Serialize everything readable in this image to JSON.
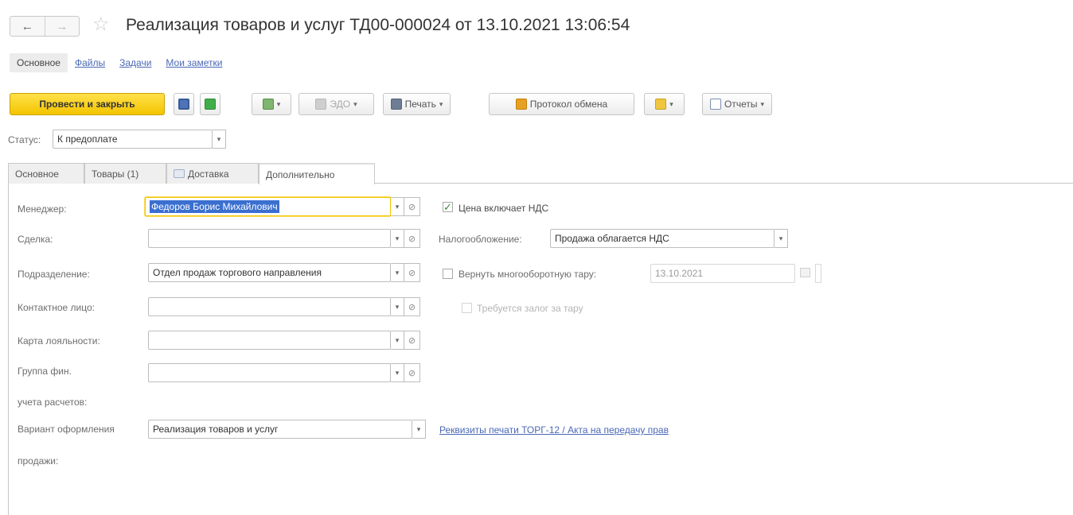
{
  "header": {
    "back": "←",
    "forward": "→",
    "star": "☆",
    "title": "Реализация товаров и услуг ТД00-000024 от 13.10.2021 13:06:54"
  },
  "section_links": [
    "Основное",
    "Файлы",
    "Задачи",
    "Мои заметки"
  ],
  "toolbar": {
    "post_close": "Провести и закрыть",
    "edo": "ЭДО",
    "print": "Печать",
    "exchange_log": "Протокол обмена",
    "reports": "Отчеты"
  },
  "status": {
    "label": "Статус:",
    "value": "К предоплате"
  },
  "tabs": [
    "Основное",
    "Товары (1)",
    "Доставка",
    "Дополнительно"
  ],
  "form": {
    "manager_label": "Менеджер:",
    "manager_value": "Федоров Борис Михайлович",
    "deal_label": "Сделка:",
    "deal_value": "",
    "division_label": "Подразделение:",
    "division_value": "Отдел продаж торгового направления",
    "contact_label": "Контактное лицо:",
    "contact_value": "",
    "loyalty_label": "Карта лояльности:",
    "loyalty_value": "",
    "fin_group_label_1": "Группа фин.",
    "fin_group_label_2": "учета расчетов:",
    "fin_group_value": "",
    "variant_label_1": "Вариант оформления",
    "variant_label_2": "продажи:",
    "variant_value": "Реализация товаров и услуг"
  },
  "right": {
    "price_vat_label": "Цена включает НДС",
    "price_vat_checked": true,
    "taxation_label": "Налогообложение:",
    "taxation_value": "Продажа облагается НДС",
    "return_tare_label": "Вернуть многооборотную тару:",
    "return_tare_date": "13.10.2021",
    "tare_deposit_label": "Требуется залог за тару",
    "print_details_link": "Реквизиты печати ТОРГ-12 / Акта на передачу прав"
  },
  "colors": {
    "primary_button": "#f3c400",
    "link": "#4a68b5",
    "selection": "#3a6fd0"
  }
}
